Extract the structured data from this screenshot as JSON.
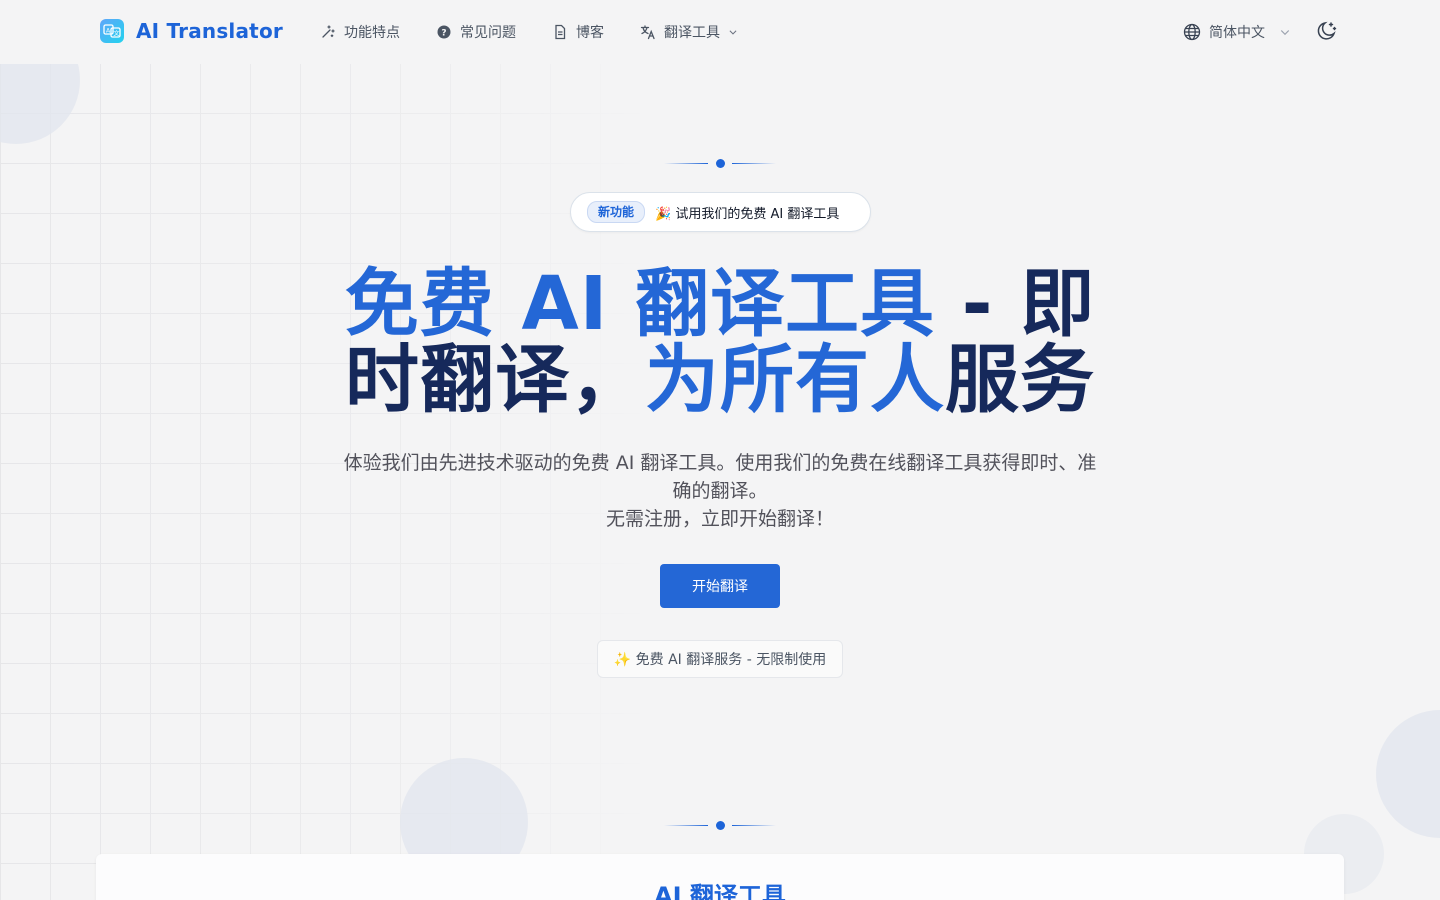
{
  "brand": {
    "name": "AI Translator",
    "icon": "translate-logo-icon"
  },
  "nav": {
    "items": [
      {
        "label": "功能特点",
        "icon": "sparkle-icon"
      },
      {
        "label": "常见问题",
        "icon": "question-circle-icon"
      },
      {
        "label": "博客",
        "icon": "document-icon"
      },
      {
        "label": "翻译工具",
        "icon": "translate-icon",
        "has_dropdown": true
      }
    ],
    "language": {
      "label": "简体中文",
      "icon": "globe-icon"
    },
    "theme_icon": "moon-icon"
  },
  "hero": {
    "badge": {
      "tag": "新功能",
      "text": "🎉 试用我们的免费 AI 翻译工具"
    },
    "title_line1_blue": "免费 AI 翻译工具",
    "title_line1_dark": " - 即",
    "title_line2_dark": "时翻译，",
    "title_line2_blue": "为所有人",
    "title_line2_dark_end": "服务",
    "description_line1": "体验我们由先进技术驱动的免费 AI 翻译工具。使用我们的免费在线翻译工具获得即时、准确的翻译。",
    "description_line2": "无需注册，立即开始翻译！",
    "cta_label": "开始翻译",
    "free_tag": "✨ 免费 AI 翻译服务 - 无限制使用"
  },
  "tool": {
    "title": "AI 翻译工具"
  },
  "colors": {
    "accent": "#2467d6",
    "dark_heading": "#16295b",
    "background": "#f4f4f5"
  }
}
